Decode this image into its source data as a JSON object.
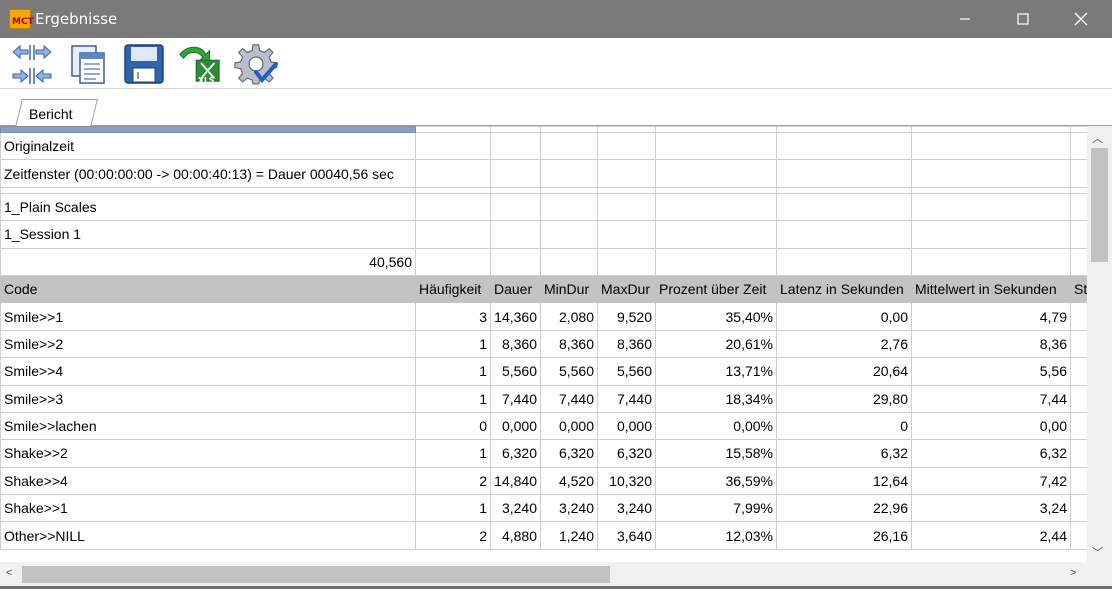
{
  "window": {
    "title": "Ergebnisse",
    "app_icon_text": "MCT",
    "minimize_icon": "minimize-icon",
    "maximize_icon": "maximize-icon",
    "close_icon": "close-icon"
  },
  "toolbar": {
    "buttons": [
      {
        "name": "swap-columns-icon"
      },
      {
        "name": "copy-icon"
      },
      {
        "name": "save-icon"
      },
      {
        "name": "export-xls-icon",
        "label": "XLS"
      },
      {
        "name": "settings-icon"
      }
    ]
  },
  "tabs": [
    {
      "label": "Bericht",
      "active": true
    }
  ],
  "report": {
    "info": [
      "Originalzeit",
      "Zeitfenster  (00:00:00:00 -> 00:00:40:13) = Dauer 00040,56 sec",
      "1_Plain Scales",
      "1_Session 1"
    ],
    "total_duration": "40,560",
    "columns": [
      "Code",
      "Häufigkeit",
      "Dauer",
      "MinDur",
      "MaxDur",
      "Prozent über Zeit",
      "Latenz in Sekunden",
      "Mittelwert in Sekunden",
      "St"
    ],
    "rows": [
      [
        "Smile>>1",
        "3",
        "14,360",
        "2,080",
        "9,520",
        "35,40%",
        "0,00",
        "4,79"
      ],
      [
        "Smile>>2",
        "1",
        "8,360",
        "8,360",
        "8,360",
        "20,61%",
        "2,76",
        "8,36"
      ],
      [
        "Smile>>4",
        "1",
        "5,560",
        "5,560",
        "5,560",
        "13,71%",
        "20,64",
        "5,56"
      ],
      [
        "Smile>>3",
        "1",
        "7,440",
        "7,440",
        "7,440",
        "18,34%",
        "29,80",
        "7,44"
      ],
      [
        "Smile>>lachen",
        "0",
        "0,000",
        "0,000",
        "0,000",
        "0,00%",
        "0",
        "0,00"
      ],
      [
        "Shake>>2",
        "1",
        "6,320",
        "6,320",
        "6,320",
        "15,58%",
        "6,32",
        "6,32"
      ],
      [
        "Shake>>4",
        "2",
        "14,840",
        "4,520",
        "10,320",
        "36,59%",
        "12,64",
        "7,42"
      ],
      [
        "Shake>>1",
        "1",
        "3,240",
        "3,240",
        "3,240",
        "7,99%",
        "22,96",
        "3,24"
      ],
      [
        "Other>>NILL",
        "2",
        "4,880",
        "1,240",
        "3,640",
        "12,03%",
        "26,16",
        "2,44"
      ]
    ]
  },
  "colors": {
    "titlebar": "#7a7a7a",
    "header_row": "#c3c3c3",
    "scrollbar_track": "#f0f0f0",
    "scrollbar_thumb": "#c2c2c2"
  }
}
